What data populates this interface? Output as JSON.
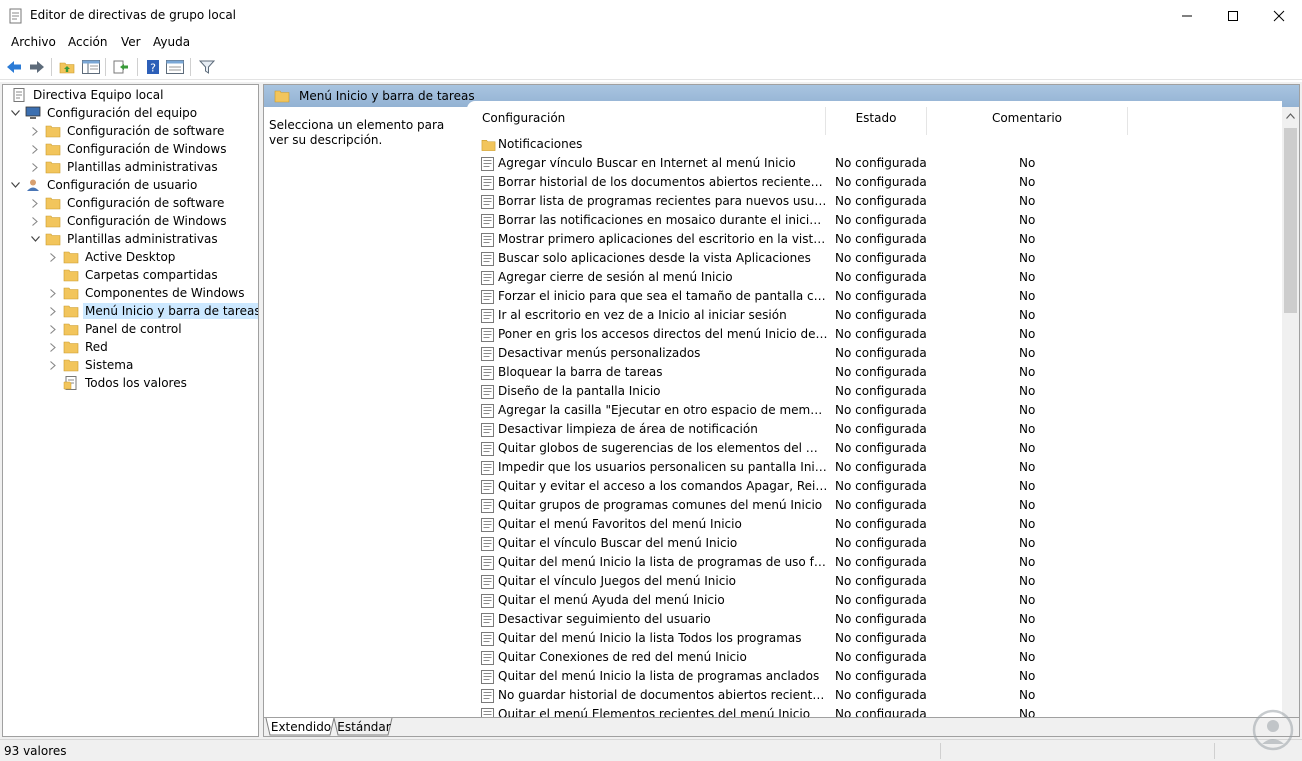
{
  "window": {
    "title": "Editor de directivas de grupo local",
    "controls": [
      "minimize",
      "maximize",
      "close"
    ]
  },
  "menubar": {
    "items": [
      "Archivo",
      "Acción",
      "Ver",
      "Ayuda"
    ]
  },
  "toolbar": {
    "buttons": [
      "back-icon",
      "forward-icon",
      "up-folder-icon",
      "show-hide-tree-icon",
      "export-list-icon",
      "help-icon",
      "properties-icon",
      "filter-icon"
    ]
  },
  "tree": [
    {
      "label": "Directiva Equipo local",
      "level": 0,
      "icon": "policy-icon",
      "chevron": ""
    },
    {
      "label": "Configuración del equipo",
      "level": 1,
      "icon": "computer-icon",
      "chevron": "open"
    },
    {
      "label": "Configuración de software",
      "level": 2,
      "icon": "folder-icon",
      "chevron": "closed"
    },
    {
      "label": "Configuración de Windows",
      "level": 2,
      "icon": "folder-icon",
      "chevron": "closed"
    },
    {
      "label": "Plantillas administrativas",
      "level": 2,
      "icon": "folder-icon",
      "chevron": "closed"
    },
    {
      "label": "Configuración de usuario",
      "level": 1,
      "icon": "user-icon",
      "chevron": "open"
    },
    {
      "label": "Configuración de software",
      "level": 2,
      "icon": "folder-icon",
      "chevron": "closed"
    },
    {
      "label": "Configuración de Windows",
      "level": 2,
      "icon": "folder-icon",
      "chevron": "closed"
    },
    {
      "label": "Plantillas administrativas",
      "level": 2,
      "icon": "folder-icon",
      "chevron": "open"
    },
    {
      "label": "Active Desktop",
      "level": 3,
      "icon": "folder-icon",
      "chevron": "closed"
    },
    {
      "label": "Carpetas compartidas",
      "level": 3,
      "icon": "folder-icon",
      "chevron": ""
    },
    {
      "label": "Componentes de Windows",
      "level": 3,
      "icon": "folder-icon",
      "chevron": "closed"
    },
    {
      "label": "Menú Inicio y barra de tareas",
      "level": 3,
      "icon": "folder-icon",
      "chevron": "closed",
      "selected": true
    },
    {
      "label": "Panel de control",
      "level": 3,
      "icon": "folder-icon",
      "chevron": "closed"
    },
    {
      "label": "Red",
      "level": 3,
      "icon": "folder-icon",
      "chevron": "closed"
    },
    {
      "label": "Sistema",
      "level": 3,
      "icon": "folder-icon",
      "chevron": "closed"
    },
    {
      "label": "Todos los valores",
      "level": 3,
      "icon": "all-settings-icon",
      "chevron": ""
    }
  ],
  "right_pane": {
    "header_title": "Menú Inicio y barra de tareas",
    "description": "Selecciona un elemento para ver su descripción.",
    "columns": {
      "setting": "Configuración",
      "state": "Estado",
      "comment": "Comentario"
    },
    "folder_row": "Notificaciones",
    "rows": [
      {
        "name": "Agregar vínculo Buscar en Internet al menú Inicio",
        "state": "No configurada",
        "comment": "No"
      },
      {
        "name": "Borrar historial de los documentos abiertos recientemente al...",
        "state": "No configurada",
        "comment": "No"
      },
      {
        "name": "Borrar lista de programas recientes para nuevos usuarios",
        "state": "No configurada",
        "comment": "No"
      },
      {
        "name": "Borrar las notificaciones en mosaico durante el inicio de sesi...",
        "state": "No configurada",
        "comment": "No"
      },
      {
        "name": "Mostrar primero aplicaciones del escritorio en la vista Aplica...",
        "state": "No configurada",
        "comment": "No"
      },
      {
        "name": "Buscar solo aplicaciones desde la vista Aplicaciones",
        "state": "No configurada",
        "comment": "No"
      },
      {
        "name": "Agregar cierre de sesión al menú Inicio",
        "state": "No configurada",
        "comment": "No"
      },
      {
        "name": "Forzar el inicio para que sea el tamaño de pantalla completa...",
        "state": "No configurada",
        "comment": "No"
      },
      {
        "name": "Ir al escritorio en vez de a Inicio al iniciar sesión",
        "state": "No configurada",
        "comment": "No"
      },
      {
        "name": "Poner en gris los accesos directos del menú Inicio de los pro...",
        "state": "No configurada",
        "comment": "No"
      },
      {
        "name": "Desactivar menús personalizados",
        "state": "No configurada",
        "comment": "No"
      },
      {
        "name": "Bloquear la barra de tareas",
        "state": "No configurada",
        "comment": "No"
      },
      {
        "name": "Diseño de la pantalla Inicio",
        "state": "No configurada",
        "comment": "No"
      },
      {
        "name": "Agregar la casilla \"Ejecutar en otro espacio de memoria\" al c...",
        "state": "No configurada",
        "comment": "No"
      },
      {
        "name": "Desactivar limpieza de área de notificación",
        "state": "No configurada",
        "comment": "No"
      },
      {
        "name": "Quitar globos de sugerencias de los elementos del menú Ini...",
        "state": "No configurada",
        "comment": "No"
      },
      {
        "name": "Impedir que los usuarios personalicen su pantalla Inicio",
        "state": "No configurada",
        "comment": "No"
      },
      {
        "name": "Quitar y evitar el acceso a los comandos Apagar, Reiniciar, S...",
        "state": "No configurada",
        "comment": "No"
      },
      {
        "name": "Quitar grupos de programas comunes del menú Inicio",
        "state": "No configurada",
        "comment": "No"
      },
      {
        "name": "Quitar el menú Favoritos del menú Inicio",
        "state": "No configurada",
        "comment": "No"
      },
      {
        "name": "Quitar el vínculo Buscar del menú Inicio",
        "state": "No configurada",
        "comment": "No"
      },
      {
        "name": "Quitar del menú Inicio la lista de programas de uso frecuente",
        "state": "No configurada",
        "comment": "No"
      },
      {
        "name": "Quitar el vínculo Juegos del menú Inicio",
        "state": "No configurada",
        "comment": "No"
      },
      {
        "name": "Quitar el menú Ayuda del menú Inicio",
        "state": "No configurada",
        "comment": "No"
      },
      {
        "name": "Desactivar seguimiento del usuario",
        "state": "No configurada",
        "comment": "No"
      },
      {
        "name": "Quitar del menú Inicio la lista Todos los programas",
        "state": "No configurada",
        "comment": "No"
      },
      {
        "name": "Quitar Conexiones de red del menú Inicio",
        "state": "No configurada",
        "comment": "No"
      },
      {
        "name": "Quitar del menú Inicio la lista de programas anclados",
        "state": "No configurada",
        "comment": "No"
      },
      {
        "name": "No guardar historial de documentos abiertos recientemente",
        "state": "No configurada",
        "comment": "No"
      },
      {
        "name": "Quitar el menú Elementos recientes del menú Inicio",
        "state": "No configurada",
        "comment": "No"
      }
    ],
    "tabs": [
      "Extendido",
      "Estándar"
    ]
  },
  "statusbar": {
    "text": "93 valores"
  },
  "colors": {
    "header_gradient": "#a8c4e0",
    "selected_bg": "#cce8ff",
    "folder": "#f2c55c",
    "back_arrow": "#2b7bd6"
  }
}
